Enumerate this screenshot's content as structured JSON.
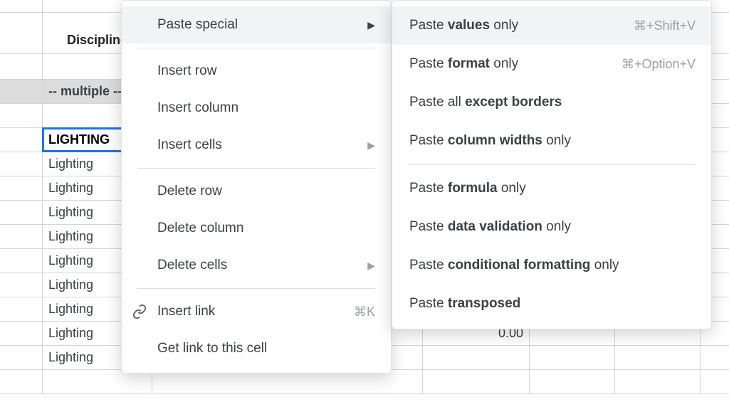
{
  "sheet": {
    "header": {
      "colB": "Discipline"
    },
    "band_text": "-- multiple --",
    "lighting_header": "LIGHTING",
    "rows": [
      "Lighting",
      "Lighting",
      "Lighting",
      "Lighting",
      "Lighting",
      "Lighting",
      "Lighting",
      "Lighting",
      "Lighting"
    ],
    "value_visible": "0.00"
  },
  "menu": {
    "paste_special": "Paste special",
    "insert_row": "Insert row",
    "insert_column": "Insert column",
    "insert_cells": "Insert cells",
    "delete_row": "Delete row",
    "delete_column": "Delete column",
    "delete_cells": "Delete cells",
    "insert_link": "Insert link",
    "insert_link_shortcut": "⌘K",
    "get_link": "Get link to this cell"
  },
  "submenu": {
    "values": {
      "pre": "Paste ",
      "b": "values",
      "post": " only",
      "shortcut": "⌘+Shift+V"
    },
    "format": {
      "pre": "Paste ",
      "b": "format",
      "post": " only",
      "shortcut": "⌘+Option+V"
    },
    "except_borders": {
      "pre": "Paste all ",
      "b": "except borders",
      "post": ""
    },
    "column_widths": {
      "pre": "Paste ",
      "b": "column widths",
      "post": " only"
    },
    "formula": {
      "pre": "Paste ",
      "b": "formula",
      "post": " only"
    },
    "data_validation": {
      "pre": "Paste ",
      "b": "data validation",
      "post": " only"
    },
    "cond_format": {
      "pre": "Paste ",
      "b": "conditional formatting",
      "post": " only"
    },
    "transposed": {
      "pre": "Paste ",
      "b": "transposed",
      "post": ""
    }
  }
}
